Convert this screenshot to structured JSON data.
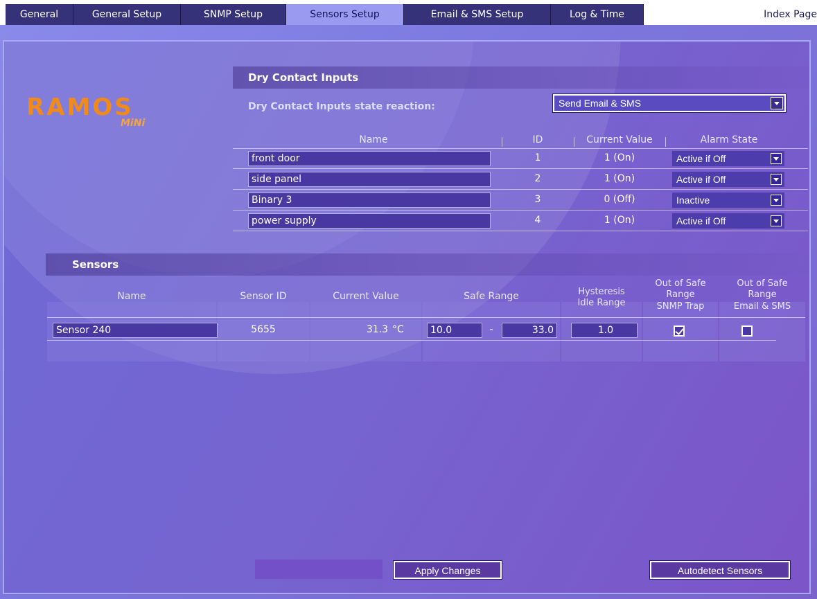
{
  "tabs": [
    {
      "label": "General"
    },
    {
      "label": "General Setup"
    },
    {
      "label": "SNMP Setup"
    },
    {
      "label": "Sensors Setup",
      "active": true
    },
    {
      "label": "Email & SMS Setup"
    },
    {
      "label": "Log & Time"
    }
  ],
  "index_link": "Index Page",
  "logo": {
    "main": "RAMOS",
    "sub": "MiNi"
  },
  "dry_contacts": {
    "title": "Dry Contact Inputs",
    "reaction_label": "Dry Contact Inputs state reaction:",
    "reaction_value": "Send Email & SMS",
    "headers": {
      "name": "Name",
      "id": "ID",
      "current_value": "Current Value",
      "alarm_state": "Alarm State"
    },
    "rows": [
      {
        "name": "front door",
        "id": "1",
        "current_value": "1 (On)",
        "alarm_state": "Active if Off"
      },
      {
        "name": "side panel",
        "id": "2",
        "current_value": "1 (On)",
        "alarm_state": "Active if Off"
      },
      {
        "name": "Binary 3",
        "id": "3",
        "current_value": "0 (Off)",
        "alarm_state": "Inactive"
      },
      {
        "name": "power supply",
        "id": "4",
        "current_value": "1 (On)",
        "alarm_state": "Active if Off"
      }
    ]
  },
  "sensors": {
    "title": "Sensors",
    "headers": {
      "name": "Name",
      "sensor_id": "Sensor ID",
      "current_value": "Current Value",
      "safe_range": "Safe Range",
      "hysteresis_1": "Hysteresis",
      "hysteresis_2": "Idle Range",
      "snmp_1": "Out of Safe",
      "snmp_2": "Range",
      "snmp_3": "SNMP Trap",
      "email_1": "Out of Safe",
      "email_2": "Range",
      "email_3": "Email & SMS"
    },
    "rows": [
      {
        "name": "Sensor 240",
        "sensor_id": "5655",
        "current_value": "31.3",
        "unit": "°C",
        "safe_min": "10.0",
        "range_sep": "-",
        "safe_max": "33.0",
        "hysteresis": "1.0",
        "snmp_trap": true,
        "email_sms": false
      }
    ]
  },
  "buttons": {
    "apply": "Apply Changes",
    "autodetect": "Autodetect Sensors"
  }
}
